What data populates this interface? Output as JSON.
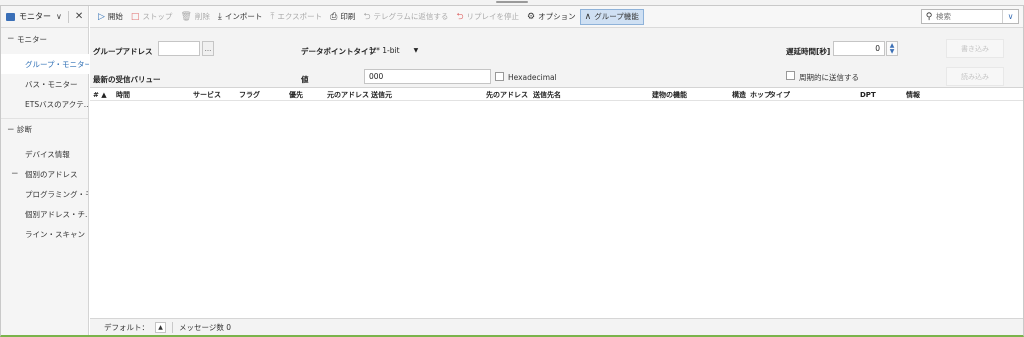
{
  "sidebar": {
    "header": {
      "title": "モニター"
    },
    "sections": [
      {
        "label": "モニター",
        "items": [
          "グループ・モニター",
          "バス・モニター",
          "ETSバスのアクテ..."
        ]
      },
      {
        "label": "診断",
        "items": [
          "デバイス情報",
          "個別のアドレス",
          "プログラミング・モ...",
          "個別アドレス・チ...",
          "ライン・スキャン"
        ]
      }
    ],
    "active_item": "グループ・モニター"
  },
  "toolbar": {
    "start": "開始",
    "stop": "ストップ",
    "delete": "削除",
    "import": "インポート",
    "export": "エクスポート",
    "print": "印刷",
    "send_telegram": "テレグラムに返信する",
    "stop_replay": "リプレイを停止",
    "options": "オプション",
    "group_functions": "グループ機能",
    "search_placeholder": "検索"
  },
  "filters": {
    "group_address_label": "グループアドレス",
    "group_address_value": "",
    "browse_label": "...",
    "datapoint_type_label": "データポイントタイプ",
    "datapoint_type_value": "1.* 1-bit",
    "delay_label": "遅延時間[秒]",
    "delay_value": "0",
    "write_button": "書き込み",
    "last_value_label": "最新の受信バリュー",
    "value_label": "値",
    "value_value": "000",
    "hexadecimal_label": "Hexadecimal",
    "periodic_send_label": "周期的に送信する",
    "read_button": "読み込み"
  },
  "table": {
    "columns": [
      "# ▲",
      "時間",
      "サービス",
      "フラグ",
      "優先",
      "元のアドレス",
      "送信元",
      "先のアドレス",
      "送信先名",
      "建物の機能",
      "構造",
      "ホップ",
      "タイプ",
      "DPT",
      "情報"
    ],
    "rows": []
  },
  "status": {
    "default_label": "デフォルト：",
    "messages_label": "メッセージ数 0"
  },
  "colors": {
    "accent": "#2e6fb5",
    "pressed_bg": "#cfe0f3",
    "bottom_bar": "#7ab34b"
  }
}
